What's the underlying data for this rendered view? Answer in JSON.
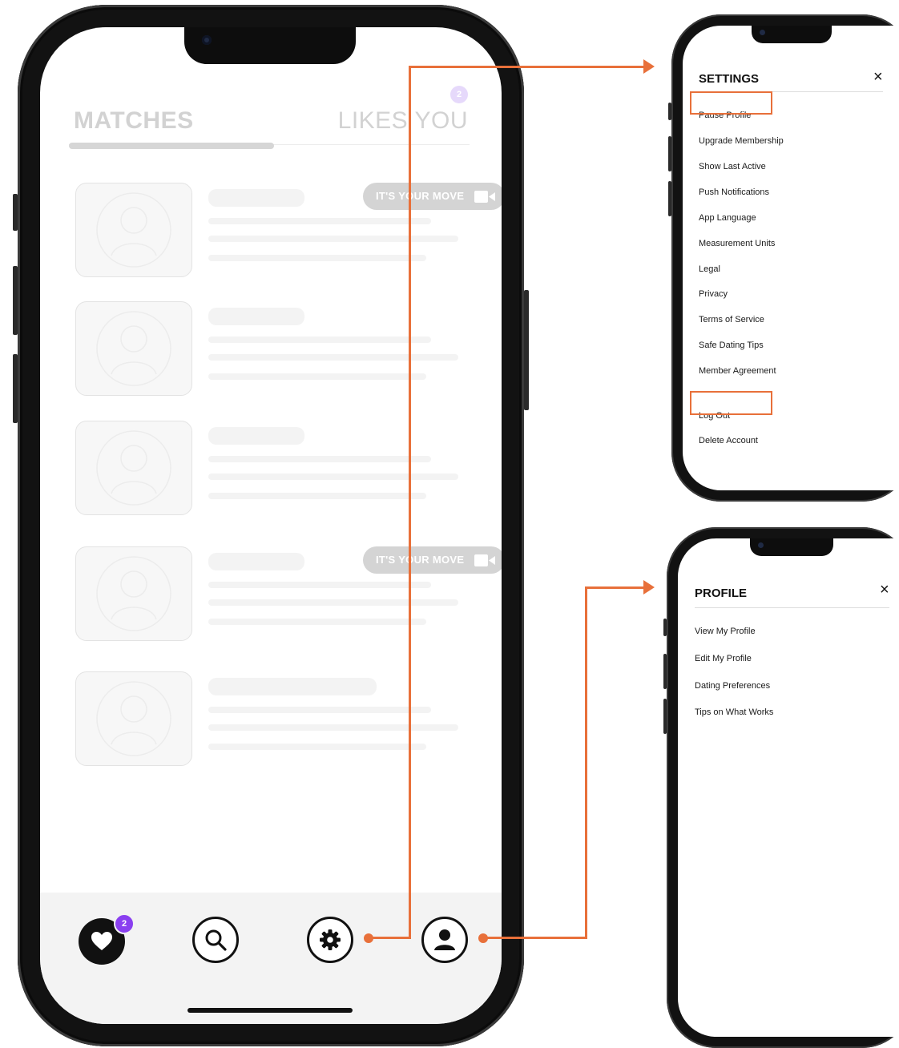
{
  "main": {
    "tabs": [
      {
        "label": "MATCHES"
      },
      {
        "label": "LIKES YOU",
        "badge": "2"
      }
    ],
    "matches": [
      {
        "move_label": "IT'S YOUR MOVE",
        "has_move": true
      },
      {
        "move_label": "",
        "has_move": false
      },
      {
        "move_label": "",
        "has_move": false
      },
      {
        "move_label": "IT'S YOUR MOVE",
        "has_move": true
      },
      {
        "move_label": "",
        "has_move": false
      }
    ],
    "bottom_nav": {
      "heart_badge": "2",
      "icons": [
        "heart-icon",
        "search-icon",
        "gear-icon",
        "user-icon"
      ]
    }
  },
  "settings_panel": {
    "title": "SETTINGS",
    "close": "×",
    "items": [
      "Pause Profile",
      "Upgrade Membership",
      "Show Last Active",
      "Push Notifications",
      "App Language",
      "Measurement Units",
      "Legal",
      "Privacy",
      "Terms of Service",
      "Safe Dating Tips",
      "Member Agreement",
      "Log Out",
      "Delete Account"
    ],
    "highlighted": [
      "Pause Profile",
      "Log Out"
    ]
  },
  "profile_panel": {
    "title": "PROFILE",
    "close": "×",
    "items": [
      "View My Profile",
      "Edit My Profile",
      "Dating Preferences",
      "Tips on What Works"
    ]
  },
  "colors": {
    "accent": "#e8703a",
    "badge": "#8a3ff0",
    "text": "#111111"
  }
}
